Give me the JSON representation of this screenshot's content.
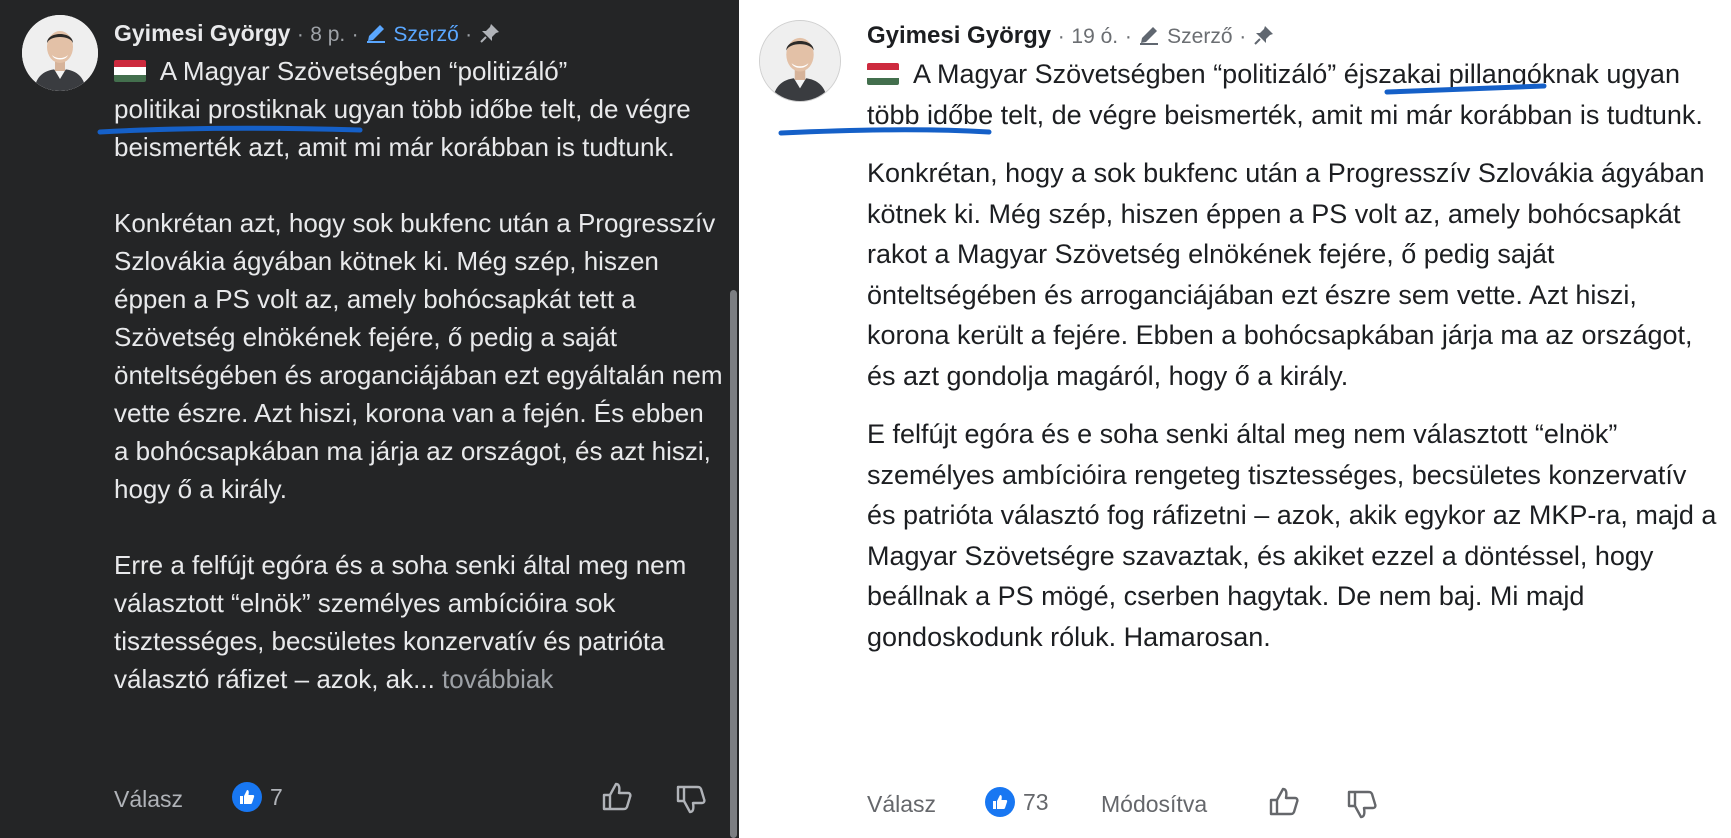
{
  "left": {
    "author": "Gyimesi György",
    "time": "8 p.",
    "author_badge": "Szerző",
    "separator": "·",
    "paragraphs": [
      {
        "text_a": " A Magyar Szövetségben “politizáló”",
        "text_b": "politikai prostiknak",
        "text_c": " ugyan több időbe telt, de végre beismerték azt, amit mi már korábban is tudtunk."
      },
      {
        "text": "Konkrétan azt, hogy sok bukfenc után a Progresszív Szlovákia ágyában kötnek ki. Még szép, hiszen éppen a PS volt az, amely bohócsapkát tett a Szövetség elnökének fejére, ő pedig a saját önteltségében és aroganciájában ezt egyáltalán nem vette észre. Azt hiszi, korona van a fején. És ebben a bohócsapkában ma járja az országot, és azt hiszi, hogy ő a király."
      },
      {
        "text": "Erre a felfújt egóra és a soha senki által meg nem választott “elnök” személyes ambícióira sok tisztességes, becsületes konzervatív és patrióta választó ráfizet – azok, ak...",
        "more": " továbbiak"
      }
    ],
    "reply": "Válasz",
    "likes": "7"
  },
  "right": {
    "author": "Gyimesi György",
    "time": "19 ó.",
    "author_badge": "Szerző",
    "separator": "·",
    "paragraphs": [
      {
        "text_a": " A Magyar Szövetségben “politizáló” ",
        "text_b": "éjszakai pillangóknak",
        "text_c": " ugyan több időbe telt, de végre beismerték, amit mi már korábban is tudtunk."
      },
      {
        "text": "Konkrétan, hogy a sok bukfenc után a Progresszív Szlovákia ágyában kötnek ki. Még szép, hiszen éppen a PS volt az, amely bohócsapkát rakot a Magyar Szövetség elnökének fejére, ő pedig saját önteltségében és arroganciájában ezt észre sem vette. Azt hiszi, korona került a fejére. Ebben a bohócsapkában járja ma az országot, és azt gondolja magáról, hogy ő a király."
      },
      {
        "text": "E felfújt egóra és e soha senki által meg nem választott “elnök” személyes ambícióira rengeteg tisztességes, becsületes konzervatív és patrióta választó fog ráfizetni – azok, akik egykor az MKP-ra, majd a Magyar Szövetségre szavaztak, és akiket ezzel a döntéssel, hogy beállnak a PS mögé, cserben hagytak. De nem baj. Mi majd gondoskodunk róluk. Hamarosan."
      }
    ],
    "reply": "Válasz",
    "likes": "73",
    "edited": "Módosítva"
  },
  "colors": {
    "dark_bg": "#242526",
    "light_bg": "#ffffff",
    "accent": "#1877f2",
    "badge_blue": "#5aa7ff",
    "ink_underline": "#1560c8"
  },
  "icons": [
    "avatar",
    "hungary-flag-icon",
    "pencil-icon",
    "pin-icon",
    "like-badge-icon",
    "thumbs-up-icon",
    "thumbs-down-icon"
  ]
}
